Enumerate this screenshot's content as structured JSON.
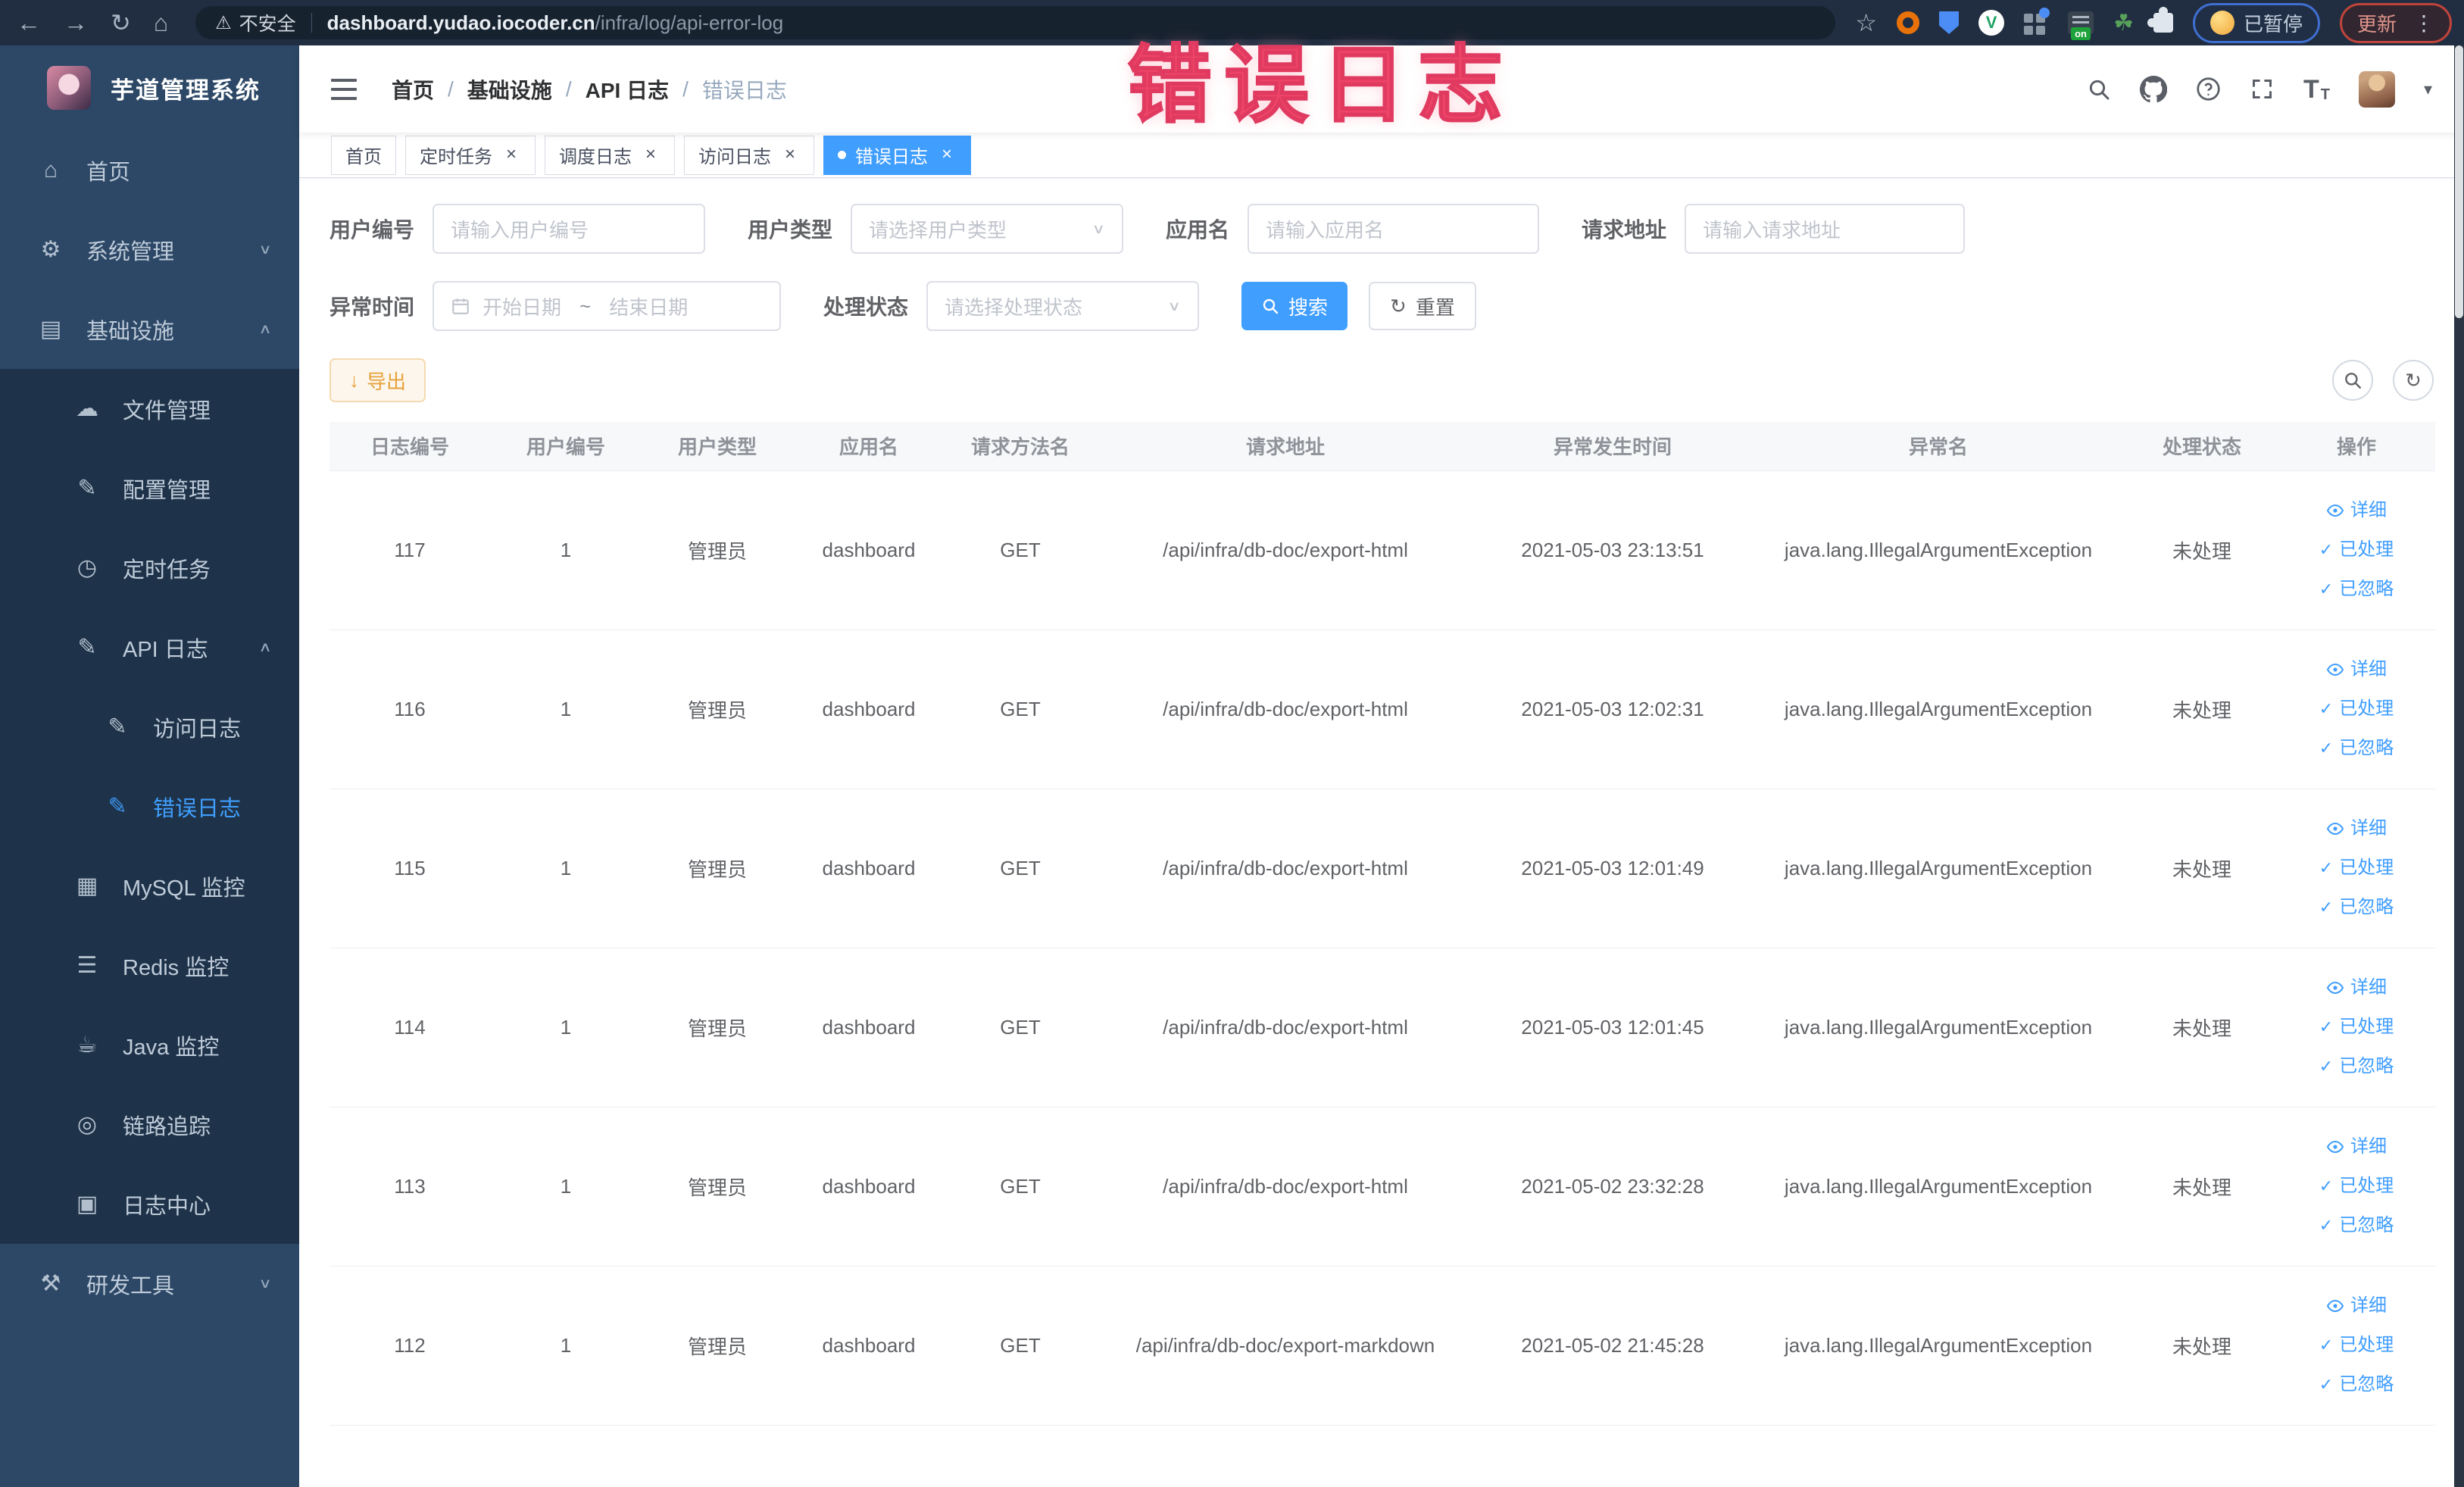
{
  "theme": {
    "accent": "#409eff",
    "warning": "#e6a23c",
    "overlay_red": "#ee4468",
    "sidebar_bg": "#2c4866",
    "submenu_bg": "#1e3349",
    "active_tab_bg": "#409eff"
  },
  "overlay_text": "错误日志",
  "browser": {
    "security_label": "不安全",
    "url_host": "dashboard.yudao.iocoder.cn",
    "url_path": "/infra/log/api-error-log",
    "paused_badge": "已暂停",
    "update_badge": "更新"
  },
  "sidebar": {
    "title": "芋道管理系统",
    "items": [
      {
        "key": "home",
        "label": "首页",
        "icon": "home-icon",
        "level": 0
      },
      {
        "key": "system-management",
        "label": "系统管理",
        "icon": "gear-icon",
        "level": 0,
        "chevron": "down"
      },
      {
        "key": "infrastructure",
        "label": "基础设施",
        "icon": "infrastructure-icon",
        "level": 0,
        "chevron": "up"
      },
      {
        "key": "file-management",
        "label": "文件管理",
        "icon": "file-manage-icon",
        "level": 1,
        "group": true
      },
      {
        "key": "config-management",
        "label": "配置管理",
        "icon": "config-manage-icon",
        "level": 1,
        "group": true
      },
      {
        "key": "scheduled-task",
        "label": "定时任务",
        "icon": "scheduled-task-icon",
        "level": 1,
        "group": true
      },
      {
        "key": "api-log",
        "label": "API 日志",
        "icon": "api-log-icon",
        "level": 1,
        "group": true,
        "chevron": "up"
      },
      {
        "key": "access-log",
        "label": "访问日志",
        "icon": "access-log-icon",
        "level": 2,
        "group": true
      },
      {
        "key": "error-log",
        "label": "错误日志",
        "icon": "error-log-icon",
        "level": 2,
        "group": true,
        "active": true
      },
      {
        "key": "mysql-monitor",
        "label": "MySQL 监控",
        "icon": "mysql-icon",
        "level": 1,
        "group": true
      },
      {
        "key": "redis-monitor",
        "label": "Redis 监控",
        "icon": "redis-icon",
        "level": 1,
        "group": true
      },
      {
        "key": "java-monitor",
        "label": "Java 监控",
        "icon": "java-icon",
        "level": 1,
        "group": true
      },
      {
        "key": "trace",
        "label": "链路追踪",
        "icon": "trace-icon",
        "level": 1,
        "group": true
      },
      {
        "key": "log-center",
        "label": "日志中心",
        "icon": "log-center-icon",
        "level": 1,
        "group": true
      },
      {
        "key": "dev-tools",
        "label": "研发工具",
        "icon": "devtools-icon",
        "level": 0,
        "chevron": "down"
      }
    ]
  },
  "header": {
    "breadcrumb": [
      {
        "key": "home",
        "label": "首页"
      },
      {
        "key": "infrastructure",
        "label": "基础设施"
      },
      {
        "key": "api-log",
        "label": "API 日志"
      },
      {
        "key": "error-log",
        "label": "错误日志",
        "current": true
      }
    ]
  },
  "tabs": [
    {
      "key": "home",
      "label": "首页",
      "closable": false
    },
    {
      "key": "scheduled-task",
      "label": "定时任务",
      "closable": true
    },
    {
      "key": "job-log",
      "label": "调度日志",
      "closable": true
    },
    {
      "key": "access-log",
      "label": "访问日志",
      "closable": true
    },
    {
      "key": "error-log",
      "label": "错误日志",
      "closable": true,
      "active": true
    }
  ],
  "filters": {
    "user_id": {
      "label": "用户编号",
      "placeholder": "请输入用户编号"
    },
    "user_type": {
      "label": "用户类型",
      "placeholder": "请选择用户类型"
    },
    "app_name": {
      "label": "应用名",
      "placeholder": "请输入应用名"
    },
    "request_url": {
      "label": "请求地址",
      "placeholder": "请输入请求地址"
    },
    "exception_time": {
      "label": "异常时间",
      "start_placeholder": "开始日期",
      "separator": "~",
      "end_placeholder": "结束日期"
    },
    "process_status": {
      "label": "处理状态",
      "placeholder": "请选择处理状态"
    },
    "search_button": "搜索",
    "reset_button": "重置"
  },
  "toolbar": {
    "export_button": "导出"
  },
  "table": {
    "columns": [
      "日志编号",
      "用户编号",
      "用户类型",
      "应用名",
      "请求方法名",
      "请求地址",
      "异常发生时间",
      "异常名",
      "处理状态",
      "操作"
    ],
    "column_keys": [
      "log_id",
      "user_id",
      "user_type",
      "app_name",
      "method",
      "url",
      "time",
      "exception",
      "status",
      "actions"
    ],
    "actions": [
      "详细",
      "已处理",
      "已忽略"
    ],
    "rows": [
      {
        "log_id": "117",
        "user_id": "1",
        "user_type": "管理员",
        "app_name": "dashboard",
        "method": "GET",
        "url": "/api/infra/db-doc/export-html",
        "time": "2021-05-03 23:13:51",
        "exception": "java.lang.IllegalArgumentException",
        "status": "未处理"
      },
      {
        "log_id": "116",
        "user_id": "1",
        "user_type": "管理员",
        "app_name": "dashboard",
        "method": "GET",
        "url": "/api/infra/db-doc/export-html",
        "time": "2021-05-03 12:02:31",
        "exception": "java.lang.IllegalArgumentException",
        "status": "未处理"
      },
      {
        "log_id": "115",
        "user_id": "1",
        "user_type": "管理员",
        "app_name": "dashboard",
        "method": "GET",
        "url": "/api/infra/db-doc/export-html",
        "time": "2021-05-03 12:01:49",
        "exception": "java.lang.IllegalArgumentException",
        "status": "未处理"
      },
      {
        "log_id": "114",
        "user_id": "1",
        "user_type": "管理员",
        "app_name": "dashboard",
        "method": "GET",
        "url": "/api/infra/db-doc/export-html",
        "time": "2021-05-03 12:01:45",
        "exception": "java.lang.IllegalArgumentException",
        "status": "未处理"
      },
      {
        "log_id": "113",
        "user_id": "1",
        "user_type": "管理员",
        "app_name": "dashboard",
        "method": "GET",
        "url": "/api/infra/db-doc/export-html",
        "time": "2021-05-02 23:32:28",
        "exception": "java.lang.IllegalArgumentException",
        "status": "未处理"
      },
      {
        "log_id": "112",
        "user_id": "1",
        "user_type": "管理员",
        "app_name": "dashboard",
        "method": "GET",
        "url": "/api/infra/db-doc/export-markdown",
        "time": "2021-05-02 21:45:28",
        "exception": "java.lang.IllegalArgumentException",
        "status": "未处理"
      }
    ]
  }
}
